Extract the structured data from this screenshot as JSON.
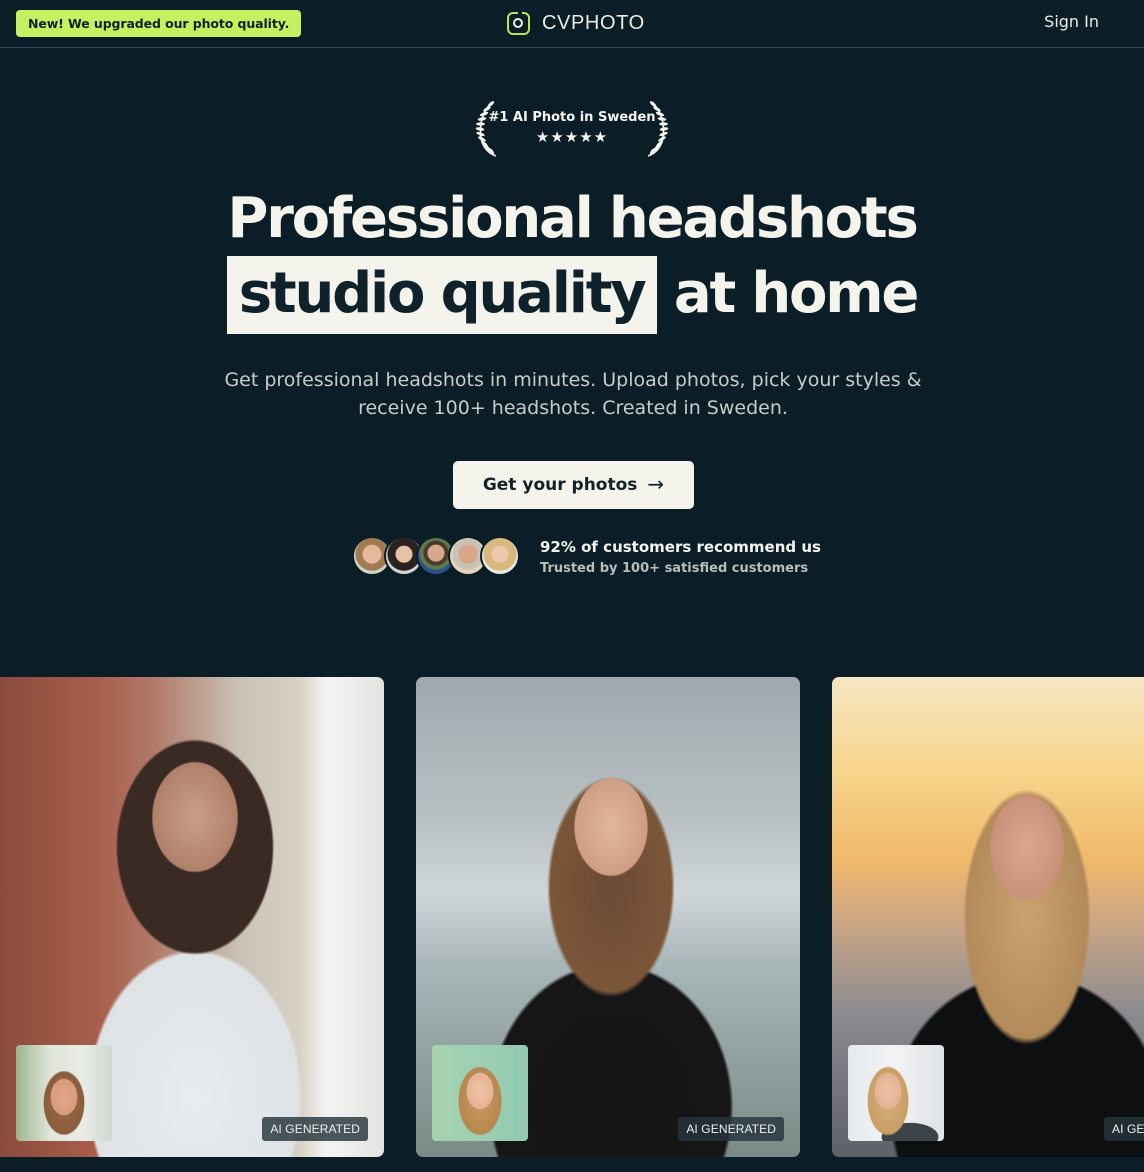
{
  "header": {
    "announcement": "New! We upgraded our photo quality.",
    "logo_text": "CVPHOTO",
    "logo_icon": "camera-icon",
    "signin_label": "Sign In"
  },
  "award": {
    "title": "#1 AI Photo in Sweden",
    "stars": "★★★★★",
    "rating": 5,
    "icon": "laurel-icon"
  },
  "hero": {
    "line1": "Professional headshots",
    "highlight": "studio quality",
    "line2_rest": "at home",
    "subtitle": "Get professional headshots in minutes. Upload photos, pick your styles & receive 100+ headshots. Created in Sweden.",
    "cta_label": "Get your photos",
    "cta_arrow": "→"
  },
  "social_proof": {
    "headline": "92% of customers recommend us",
    "subline": "Trusted by 100+ satisfied customers",
    "avatar_count": 5
  },
  "gallery": {
    "cards": [
      {
        "badge": "AI GENERATED",
        "scene": "city street, woman in white shirt"
      },
      {
        "badge": "AI GENERATED",
        "scene": "office, woman in black top"
      },
      {
        "badge": "AI GENERATED",
        "scene": "sunset skyline, woman in black shirt"
      }
    ]
  },
  "colors": {
    "background": "#0b1e27",
    "accent_lime": "#c5f060",
    "cream": "#f4f3ec",
    "text_muted": "#c8cbc8"
  }
}
